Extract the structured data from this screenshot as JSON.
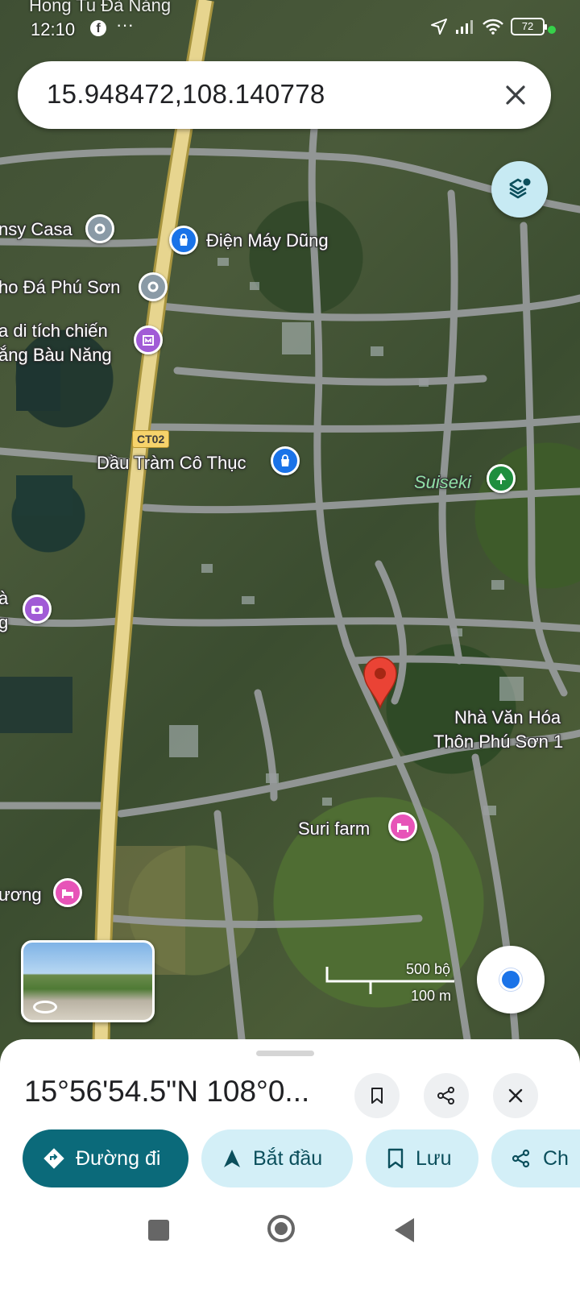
{
  "status_bar": {
    "top_label": "Hong Tu Đà Nẵng",
    "time": "12:10",
    "facebook_glyph": "f",
    "more": "···",
    "battery": "72"
  },
  "search": {
    "query": "15.948472,108.140778"
  },
  "map": {
    "road_badge": "CT02",
    "places": [
      {
        "label": "nsy Casa",
        "icon": "place-pin-icon",
        "color": "#8a9aa6"
      },
      {
        "label": "Điện Máy Dũng",
        "icon": "shopping-bag-icon",
        "color": "#1a73e8"
      },
      {
        "label": "ho Đá Phú Sơn",
        "icon": "place-pin-icon",
        "color": "#8a9aa6"
      },
      {
        "label": "a di tích chiến",
        "label2": "ắng Bàu Năng",
        "icon": "museum-icon",
        "color": "#a15bd6"
      },
      {
        "label": "Dầu Tràm Cô Thục",
        "icon": "shopping-bag-icon",
        "color": "#1a73e8"
      },
      {
        "label": "Suiseki",
        "icon": "tree-icon",
        "color": "#1e8e3e"
      },
      {
        "label": "à",
        "label2": "g",
        "icon": "camera-icon",
        "color": "#a15bd6"
      },
      {
        "label": "Nhà Văn Hóa",
        "label2": "Thôn Phú Sơn 1",
        "icon": "",
        "color": ""
      },
      {
        "label": "Suri farm",
        "icon": "bed-icon",
        "color": "#e754b8"
      },
      {
        "label": "ương",
        "icon": "bed-icon",
        "color": "#e754b8"
      }
    ],
    "scale": {
      "top": "500 bộ",
      "bottom": "100 m"
    },
    "accent": "#ea4335"
  },
  "sheet": {
    "coords": "15°56'54.5\"N 108°0...",
    "actions": [
      {
        "label": "Đường đi",
        "icon": "directions-icon"
      },
      {
        "label": "Bắt đầu",
        "icon": "navigation-arrow-icon"
      },
      {
        "label": "Lưu",
        "icon": "bookmark-icon"
      },
      {
        "label": "Ch",
        "icon": "share-icon"
      }
    ],
    "primary_color": "#0b6a7a",
    "chip_color": "#d3eff7"
  }
}
